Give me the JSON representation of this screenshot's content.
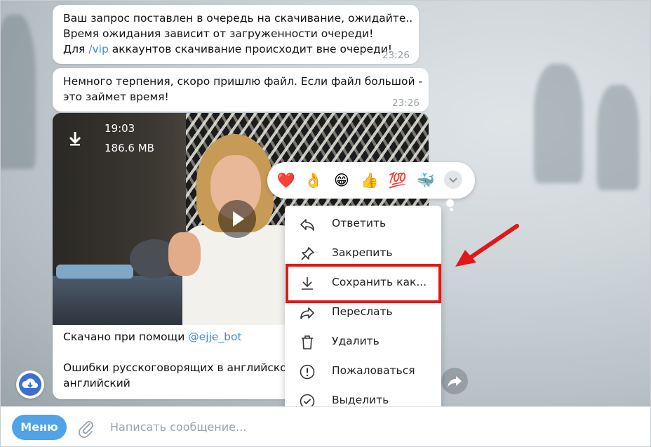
{
  "messages": [
    {
      "lines": [
        "Ваш запрос поставлен в очередь на скачивание, ожидайте..",
        "Время ожидания зависит от загруженности очереди!"
      ],
      "line3_pre": "Для ",
      "line3_link": "/vip",
      "line3_post": " аккаунтов скачивание происходит вне очереди!",
      "time": "23:26"
    },
    {
      "lines": [
        "Немного терпения, скоро пришлю файл. Если файл большой -",
        "это займет время!"
      ],
      "time": "23:26"
    }
  ],
  "video": {
    "duration": "19:03",
    "size": "186.6 MB",
    "caption_pre": "Скачано при помощи ",
    "caption_link": "@ejje_bot",
    "caption_line2": "Ошибки русскоговорящих в английском",
    "caption_line3": "английский"
  },
  "reactions": [
    "❤️",
    "👌",
    "😁",
    "👍",
    "💯",
    "🐳"
  ],
  "context_menu": {
    "items": [
      {
        "label": "Ответить",
        "icon": "reply-icon"
      },
      {
        "label": "Закрепить",
        "icon": "pin-icon"
      },
      {
        "label": "Сохранить как...",
        "icon": "download-icon"
      },
      {
        "label": "Переслать",
        "icon": "forward-icon"
      },
      {
        "label": "Удалить",
        "icon": "trash-icon"
      },
      {
        "label": "Пожаловаться",
        "icon": "report-icon"
      },
      {
        "label": "Выделить",
        "icon": "select-icon"
      }
    ]
  },
  "input": {
    "menu_label": "Меню",
    "placeholder": "Написать сообщение..."
  },
  "colors": {
    "accent": "#4fa3e6",
    "link": "#3a8fd6",
    "highlight": "#e01818"
  }
}
